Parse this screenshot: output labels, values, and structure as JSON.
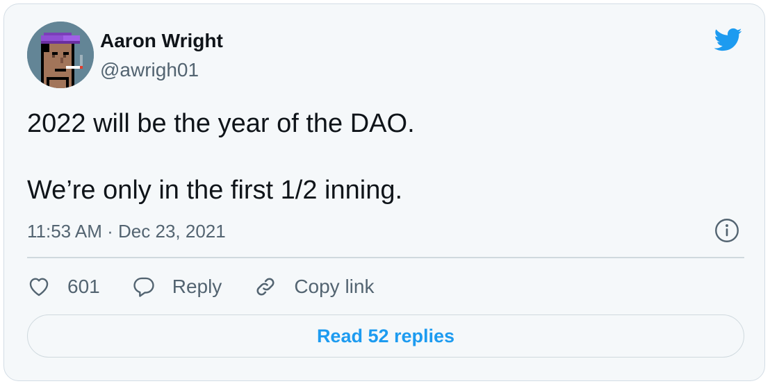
{
  "author": {
    "name": "Aaron Wright",
    "handle": "@awrigh01"
  },
  "tweet": {
    "line1": "2022 will be the year of the DAO.",
    "line2": "We’re only in the first 1/2 inning.",
    "timestamp": "11:53 AM · Dec 23, 2021"
  },
  "actions": {
    "like_count": "601",
    "reply_label": "Reply",
    "copy_link_label": "Copy link"
  },
  "read_replies_label": "Read 52 replies",
  "icons": {
    "brand": "twitter-bird-icon",
    "info": "info-icon",
    "like": "heart-icon",
    "reply": "speech-bubble-icon",
    "copy": "link-icon"
  },
  "colors": {
    "brand_blue": "#1d9bf0",
    "secondary_text": "#536471",
    "primary_text": "#0f1419",
    "card_bg": "#f5f8fa"
  }
}
